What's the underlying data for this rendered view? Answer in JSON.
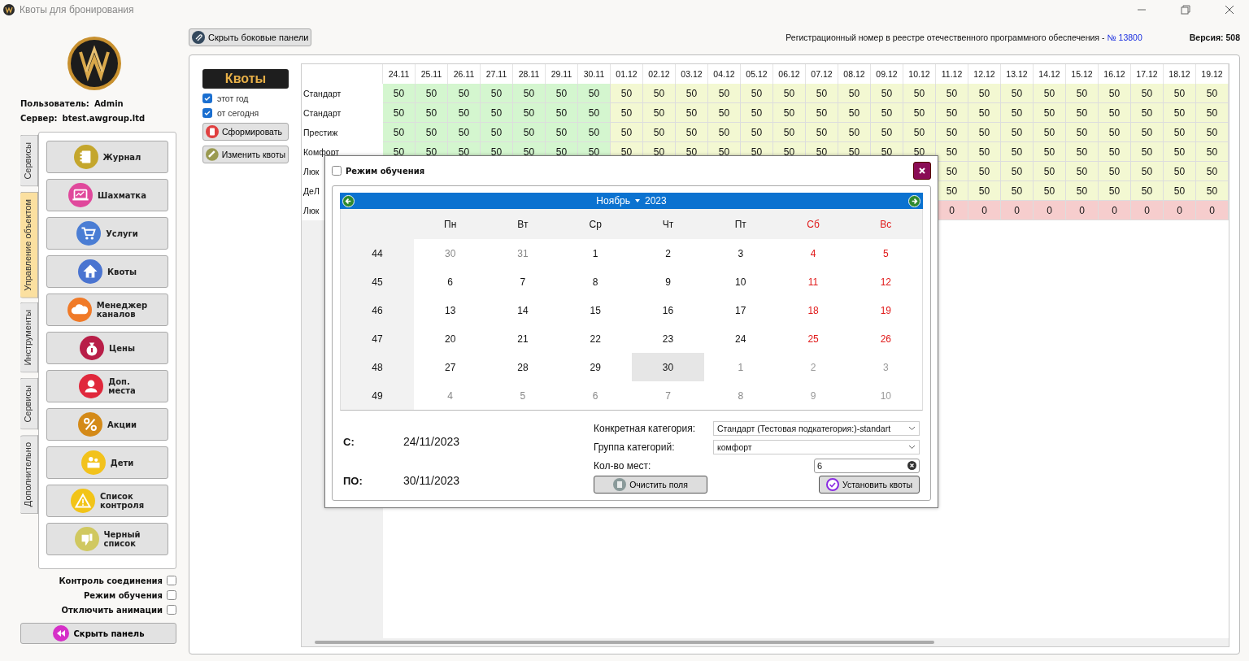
{
  "window": {
    "title": "Квоты для бронирования"
  },
  "sidebar": {
    "user_label": "Пользователь:",
    "user": "Admin",
    "server_label": "Сервер:",
    "server": "btest.awgroup.ltd",
    "tabs": [
      {
        "label": "Сервисы",
        "selected": false
      },
      {
        "label": "Управление объектом",
        "selected": true
      },
      {
        "label": "Инструменты",
        "selected": false
      },
      {
        "label": "Сервисы",
        "selected": false
      },
      {
        "label": "Дополнительно",
        "selected": false
      }
    ],
    "menu": [
      {
        "label": "Журнал",
        "color": "#c4a62c"
      },
      {
        "label": "Шахматка",
        "color": "#e0489c"
      },
      {
        "label": "Услуги",
        "color": "#4a7dd4"
      },
      {
        "label": "Квоты",
        "color": "#4a74d0"
      },
      {
        "label": "Менеджер\nканалов",
        "color": "#f07a28"
      },
      {
        "label": "Цены",
        "color": "#b81e48"
      },
      {
        "label": "Доп.\nместа",
        "color": "#e0283c"
      },
      {
        "label": "Акции",
        "color": "#d48a18"
      },
      {
        "label": "Дети",
        "color": "#f2c21c"
      },
      {
        "label": "Список\nконтроля",
        "color": "#f2c418"
      },
      {
        "label": "Черный\nсписок",
        "color": "#d0c860"
      }
    ],
    "options": [
      {
        "label": "Контроль соединения",
        "checked": false
      },
      {
        "label": "Режим обучения",
        "checked": false
      },
      {
        "label": "Отключить анимации",
        "checked": false
      }
    ],
    "hide_button": "Скрыть панель"
  },
  "toolbar": {
    "hide_sides_button": "Скрыть боковые панели",
    "registry_text": "Регистрационный номер в реестре отечественного программного обеспечения -",
    "registry_link": "№ 13800",
    "version_label": "Версия:",
    "version": "508"
  },
  "quotas": {
    "title": "Квоты",
    "filters": [
      {
        "label": "этот год",
        "checked": true
      },
      {
        "label": "от сегодня",
        "checked": true
      }
    ],
    "buttons": [
      "Сформировать",
      "Изменить квоты"
    ]
  },
  "table": {
    "columns": [
      {
        "label": "24.11",
        "in_range": true
      },
      {
        "label": "25.11",
        "in_range": true
      },
      {
        "label": "26.11",
        "in_range": true
      },
      {
        "label": "27.11",
        "in_range": true
      },
      {
        "label": "28.11",
        "in_range": true
      },
      {
        "label": "29.11",
        "in_range": true
      },
      {
        "label": "30.11",
        "in_range": true
      },
      {
        "label": "01.12",
        "in_range": false
      },
      {
        "label": "02.12",
        "in_range": false
      },
      {
        "label": "03.12",
        "in_range": false
      },
      {
        "label": "04.12",
        "in_range": false
      },
      {
        "label": "05.12",
        "in_range": false
      },
      {
        "label": "06.12",
        "in_range": false
      },
      {
        "label": "07.12",
        "in_range": false
      },
      {
        "label": "08.12",
        "in_range": false
      },
      {
        "label": "09.12",
        "in_range": false
      },
      {
        "label": "10.12",
        "in_range": false
      },
      {
        "label": "11.12",
        "in_range": false
      },
      {
        "label": "12.12",
        "in_range": false
      },
      {
        "label": "13.12",
        "in_range": false
      },
      {
        "label": "14.12",
        "in_range": false
      },
      {
        "label": "15.12",
        "in_range": false
      },
      {
        "label": "16.12",
        "in_range": false
      },
      {
        "label": "17.12",
        "in_range": false
      },
      {
        "label": "18.12",
        "in_range": false
      },
      {
        "label": "19.12",
        "in_range": false
      }
    ],
    "rows": [
      {
        "label": "Стандарт",
        "closed": false,
        "cells": [
          "50",
          "50",
          "50",
          "50",
          "50",
          "50",
          "50",
          "50",
          "50",
          "50",
          "50",
          "50",
          "50",
          "50",
          "50",
          "50",
          "50",
          "50",
          "50",
          "50",
          "50",
          "50",
          "50",
          "50",
          "50",
          "50"
        ]
      },
      {
        "label": "Стандарт",
        "closed": false,
        "cells": [
          "50",
          "50",
          "50",
          "50",
          "50",
          "50",
          "50",
          "50",
          "50",
          "50",
          "50",
          "50",
          "50",
          "50",
          "50",
          "50",
          "50",
          "50",
          "50",
          "50",
          "50",
          "50",
          "50",
          "50",
          "50",
          "50"
        ]
      },
      {
        "label": "Престиж",
        "closed": false,
        "cells": [
          "50",
          "50",
          "50",
          "50",
          "50",
          "50",
          "50",
          "50",
          "50",
          "50",
          "50",
          "50",
          "50",
          "50",
          "50",
          "50",
          "50",
          "50",
          "50",
          "50",
          "50",
          "50",
          "50",
          "50",
          "50",
          "50"
        ]
      },
      {
        "label": "Комфорт",
        "closed": false,
        "cells": [
          "50",
          "50",
          "50",
          "50",
          "50",
          "50",
          "50",
          "50",
          "50",
          "50",
          "50",
          "50",
          "50",
          "50",
          "50",
          "50",
          "50",
          "50",
          "50",
          "50",
          "50",
          "50",
          "50",
          "50",
          "50",
          "50"
        ]
      },
      {
        "label": "Люк",
        "closed": false,
        "cells": [
          null,
          null,
          null,
          null,
          null,
          null,
          null,
          null,
          null,
          null,
          null,
          null,
          null,
          null,
          null,
          null,
          null,
          "50",
          "50",
          "50",
          "50",
          "50",
          "50",
          "50",
          "50",
          "50"
        ]
      },
      {
        "label": "ДеЛ",
        "closed": false,
        "cells": [
          null,
          null,
          null,
          null,
          null,
          null,
          null,
          null,
          null,
          null,
          null,
          null,
          null,
          null,
          null,
          null,
          null,
          "50",
          "50",
          "50",
          "50",
          "50",
          "50",
          "50",
          "50",
          "50"
        ]
      },
      {
        "label": "Люк",
        "closed": true,
        "cells": [
          null,
          null,
          null,
          null,
          null,
          null,
          null,
          null,
          null,
          null,
          null,
          null,
          null,
          null,
          null,
          null,
          null,
          "0",
          "0",
          "0",
          "0",
          "0",
          "0",
          "0",
          "0",
          "0"
        ]
      }
    ]
  },
  "dialog": {
    "training_mode": {
      "label": "Режим обучения",
      "checked": false
    },
    "calendar": {
      "month": "Ноябрь",
      "year": "2023",
      "weekdays": [
        {
          "label": "Пн",
          "weekend": false
        },
        {
          "label": "Вт",
          "weekend": false
        },
        {
          "label": "Ср",
          "weekend": false
        },
        {
          "label": "Чт",
          "weekend": false
        },
        {
          "label": "Пт",
          "weekend": false
        },
        {
          "label": "Сб",
          "weekend": true
        },
        {
          "label": "Вс",
          "weekend": true
        }
      ],
      "weeks": [
        {
          "number": "44",
          "days": [
            {
              "day": "30",
              "other_month": true,
              "selected": false
            },
            {
              "day": "31",
              "other_month": true,
              "selected": false
            },
            {
              "day": "1",
              "other_month": false,
              "selected": false
            },
            {
              "day": "2",
              "other_month": false,
              "selected": false
            },
            {
              "day": "3",
              "other_month": false,
              "selected": false
            },
            {
              "day": "4",
              "other_month": false,
              "selected": false
            },
            {
              "day": "5",
              "other_month": false,
              "selected": false
            }
          ]
        },
        {
          "number": "45",
          "days": [
            {
              "day": "6",
              "other_month": false,
              "selected": false
            },
            {
              "day": "7",
              "other_month": false,
              "selected": false
            },
            {
              "day": "8",
              "other_month": false,
              "selected": false
            },
            {
              "day": "9",
              "other_month": false,
              "selected": false
            },
            {
              "day": "10",
              "other_month": false,
              "selected": false
            },
            {
              "day": "11",
              "other_month": false,
              "selected": false
            },
            {
              "day": "12",
              "other_month": false,
              "selected": false
            }
          ]
        },
        {
          "number": "46",
          "days": [
            {
              "day": "13",
              "other_month": false,
              "selected": false
            },
            {
              "day": "14",
              "other_month": false,
              "selected": false
            },
            {
              "day": "15",
              "other_month": false,
              "selected": false
            },
            {
              "day": "16",
              "other_month": false,
              "selected": false
            },
            {
              "day": "17",
              "other_month": false,
              "selected": false
            },
            {
              "day": "18",
              "other_month": false,
              "selected": false
            },
            {
              "day": "19",
              "other_month": false,
              "selected": false
            }
          ]
        },
        {
          "number": "47",
          "days": [
            {
              "day": "20",
              "other_month": false,
              "selected": false
            },
            {
              "day": "21",
              "other_month": false,
              "selected": false
            },
            {
              "day": "22",
              "other_month": false,
              "selected": false
            },
            {
              "day": "23",
              "other_month": false,
              "selected": false
            },
            {
              "day": "24",
              "other_month": false,
              "selected": false
            },
            {
              "day": "25",
              "other_month": false,
              "selected": false
            },
            {
              "day": "26",
              "other_month": false,
              "selected": false
            }
          ]
        },
        {
          "number": "48",
          "days": [
            {
              "day": "27",
              "other_month": false,
              "selected": false
            },
            {
              "day": "28",
              "other_month": false,
              "selected": false
            },
            {
              "day": "29",
              "other_month": false,
              "selected": false
            },
            {
              "day": "30",
              "other_month": false,
              "selected": true
            },
            {
              "day": "1",
              "other_month": true,
              "selected": false
            },
            {
              "day": "2",
              "other_month": true,
              "selected": false
            },
            {
              "day": "3",
              "other_month": true,
              "selected": false
            }
          ]
        },
        {
          "number": "49",
          "days": [
            {
              "day": "4",
              "other_month": true,
              "selected": false
            },
            {
              "day": "5",
              "other_month": true,
              "selected": false
            },
            {
              "day": "6",
              "other_month": true,
              "selected": false
            },
            {
              "day": "7",
              "other_month": true,
              "selected": false
            },
            {
              "day": "8",
              "other_month": true,
              "selected": false
            },
            {
              "day": "9",
              "other_month": true,
              "selected": false
            },
            {
              "day": "10",
              "other_month": true,
              "selected": false
            }
          ]
        }
      ]
    },
    "from_label": "С:",
    "from": "24/11/2023",
    "to_label": "ПО:",
    "to": "30/11/2023",
    "fields": [
      {
        "label": "Конкретная категория:",
        "kind": "select",
        "value": "Стандарт (Тестовая подкатегория:)-standart"
      },
      {
        "label": "Группа категорий:",
        "kind": "select",
        "value": "комфорт"
      },
      {
        "label": "Кол-во мест:",
        "kind": "input",
        "value": "6"
      }
    ],
    "buttons": [
      "Очистить поля",
      "Установить квоты"
    ]
  }
}
